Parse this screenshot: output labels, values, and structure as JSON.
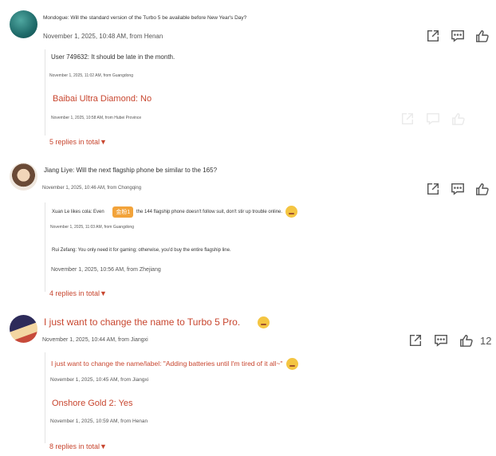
{
  "threads": [
    {
      "comment": "Mondogue: Will the standard version of the Turbo 5 be available before New Year's Day?",
      "meta": "November 1, 2025, 10:48 AM, from Henan",
      "replies": [
        {
          "text": "User 749632: It should be late in the month.",
          "meta": "November 1, 2025, 11:02 AM, from Guangdong"
        },
        {
          "text": "Baibai Ultra Diamond: No",
          "meta": "November 1, 2025, 10:58 AM, from Hubei Province"
        }
      ],
      "more": "5 replies in total▼"
    },
    {
      "comment": "Jiang Liye: Will the next flagship phone be similar to the 165?",
      "meta": "November 1, 2025, 10:46 AM, from Chongqing",
      "replies": [
        {
          "name": "Xuan Le likes cola: Even",
          "badge": "金粉1",
          "text": "the 144 flagship phone doesn't follow suit, don't stir up trouble online.",
          "meta": "November 1, 2025, 11:03 AM, from Guangdong"
        },
        {
          "text": "Rui Zefang: You only need it for gaming; otherwise, you'd buy the entire flagship line.",
          "meta": "November 1, 2025, 10:56 AM, from Zhejiang"
        }
      ],
      "more": "4 replies in total▼"
    },
    {
      "comment": "I just want to change the name to Turbo 5 Pro.",
      "meta": "November 1, 2025, 10:44 AM, from Jiangxi",
      "likes": "12",
      "replies": [
        {
          "text": "I just want to change the name/label: \"Adding batteries until I'm tired of it all~\"",
          "meta": "November 1, 2025, 10:45 AM, from Jiangxi"
        },
        {
          "text": "Onshore Gold 2: Yes",
          "meta": "November 1, 2025, 10:59 AM, from Henan"
        }
      ],
      "more": "8 replies in total▼"
    }
  ],
  "icons": {
    "share": "share-icon",
    "comment": "comment-icon",
    "like": "thumbs-up-icon",
    "emoji": "emoji-icon"
  },
  "colors": {
    "accent": "#c8462f",
    "text": "#333333",
    "meta": "#555555"
  }
}
